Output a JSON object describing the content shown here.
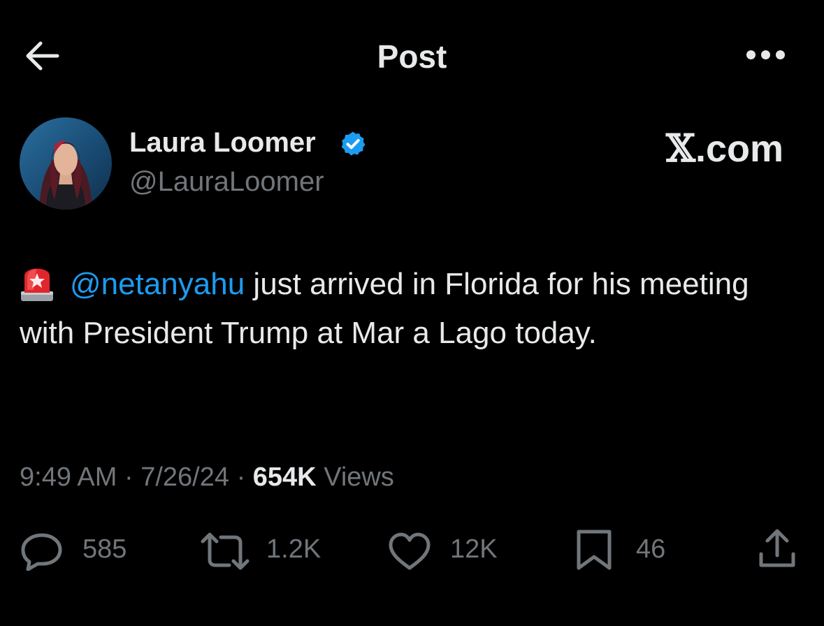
{
  "header": {
    "title": "Post",
    "back_icon": "arrow-left-icon",
    "more_icon": "more-horizontal-icon"
  },
  "author": {
    "display_name": "Laura Loomer",
    "handle": "@LauraLoomer",
    "verified_icon": "verified-badge-icon",
    "verified_color": "#1d9bf0"
  },
  "watermark": {
    "x": "𝕏",
    "suffix": ".com"
  },
  "tweet": {
    "emoji_icon": "rotating-light-icon",
    "mention": "@netanyahu",
    "text": " just arrived in Florida for his meeting with President Trump at Mar a Lago today."
  },
  "meta": {
    "time": "9:49 AM",
    "separator": "·",
    "date": "7/26/24",
    "views_count": "654K",
    "views_label": "Views"
  },
  "actions": {
    "reply": {
      "icon": "reply-icon",
      "count": "585"
    },
    "repost": {
      "icon": "repost-icon",
      "count": "1.2K"
    },
    "like": {
      "icon": "heart-icon",
      "count": "12K"
    },
    "bookmark": {
      "icon": "bookmark-icon",
      "count": "46"
    },
    "share": {
      "icon": "share-icon"
    }
  },
  "colors": {
    "background": "#000000",
    "text_primary": "#e7e9ea",
    "text_secondary": "#71767b",
    "accent": "#1d9bf0"
  }
}
